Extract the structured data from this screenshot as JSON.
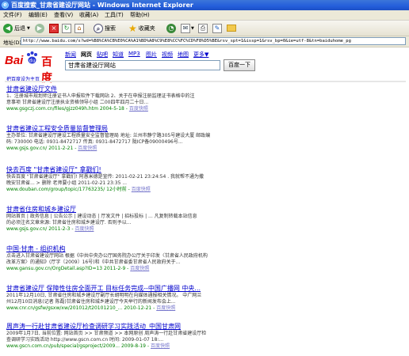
{
  "window": {
    "title": "百度搜索_甘肃省建设厅网站 - Windows Internet Explorer",
    "accent": "#245edb"
  },
  "menu": [
    "文件(F)",
    "编辑(E)",
    "查看(V)",
    "收藏(A)",
    "工具(T)",
    "帮助(H)"
  ],
  "toolbar": {
    "back": "后退",
    "search": "搜索",
    "favorites": "收藏夹",
    "icons": [
      "back-icon",
      "forward-icon",
      "stop-icon",
      "refresh-icon",
      "home-icon",
      "search-icon",
      "favorites-icon",
      "history-icon",
      "mail-icon",
      "print-icon",
      "edit-icon"
    ]
  },
  "address": {
    "label": "地址(D)",
    "url": "http://www.baidu.com/s?wd=%B8%CA%CB%E0%CA%A1%BD%A8%C9%E8%CC%FC%CD%F8%D5%BE&rsv_spt=1&issp=1&rsv_bp=0&ie=utf-8&tn=baiduhome_pg"
  },
  "baidu": {
    "logo_bai": "Bai",
    "logo_du": "百度",
    "tabs": [
      "新闻",
      "网页",
      "贴吧",
      "知道",
      "MP3",
      "图片",
      "视频",
      "地图",
      "更多▼"
    ],
    "active_tab": "网页",
    "query": "甘肃省建设厅网站",
    "button": "百度一下",
    "set_home": "把百度设为主页"
  },
  "results": [
    {
      "title": "甘肃省建设厅文件",
      "desc1": "1、注册城市规划师注册证书人申报软件下载网站 2、关于在申报注册监理证书表格中的注",
      "desc2": "意事项 甘肃省建设厅注册执业资格领导小组 二00四年四月二十日...",
      "url": "www.gsgczj.com.cn/files/gjzz049h.htm 2004-5-18",
      "snap": "百度快照"
    },
    {
      "title": "甘肃省建设工程安全质量监督管理局",
      "desc1": "主办单位: 甘肃省建设厅建设工程质量安全监督管理局 地址: 兰州市静宁路305号建设大厦 邮政编",
      "desc2": "码: 730000 电话: 0931-8472717 传真: 0931-8472717 陇ICP备09000496号...",
      "url": "www.gsjs.gov.cn/ 2011-2-21",
      "snap": "百度快照"
    },
    {
      "title": "快去百度 \"甘肃省建设厅\" 拿戳们!",
      "desc1": "快去百度 \"甘肃省建设厅\" 拿戳们! 阿愚米德是宣传: 2011-02-21 23:24:54 . 我就帮不通为撒",
      "desc2": "晚安甘肃省... > 删除 老师要小组 2011-02-21 23:35 ...",
      "url": "www.douban.com/group/topic/17763235/ 12小时前",
      "snap": "百度快照"
    },
    {
      "title": "甘肃省住房和城乡建设厅",
      "desc1": "网站首页 | 政务信息 | 公告公示 | 建设动态 | 厅发文件 | 招标投标 | ... 凡复制转载本站信息",
      "desc2": "的必须注名文章来源: 甘肃省住房和城乡建设厅. 否则予以...",
      "url": "www.gsjs.gov.cn/ 2011-2-3",
      "snap": "百度快照"
    },
    {
      "title": "中国·甘肃 - 组织机构",
      "desc1": "点击进入甘肃省建设厅网站 根据《中共中央办公厅国务院办公厅关于印发〈甘肃省人民政府机构",
      "desc2": "改革方案〉的通知》(厅字〔2009〕16号)和《中共甘肃省委甘肃省人民政府关于...",
      "url": "www.gansu.gov.cn/OrgDetail.asp?ID=13 2011-2-9",
      "snap": "百度快照"
    },
    {
      "title": "甘肃省建设厅 保障性住房全面开工 目标任务完成--中国广播网 中央...",
      "desc1": "2011年12月10日, 甘肃省住房和城乡建设厅副厅长胡明明在向媒体通报相关情况。 中广网兰",
      "desc2": "州12月10日消息(记者 陈磊)甘肃省住房和城乡建设厅今天举行的新闻发布会上...",
      "url": "www.cnr.cn/gsfw/gsxw/xw/201012/t20101210_... 2010-12-21",
      "snap": "百度快照"
    },
    {
      "title": "周声涛一行赴甘肃省建设厅检查调研学习实践活动_中国甘肃网",
      "desc1": "2009年1月7日, 当前位置: 网站首页 >> 甘肃频道 >> 本网原创 周声涛一行赴甘肃省建设厅检",
      "desc2": "查调研学习实践活动 http://www.gscn.com.cn 时间: 2009-01-07 18:...",
      "url": "www.gscn.com.cn/pub/special/gsproject/2009... 2009-8-19",
      "snap": "百度快照"
    }
  ]
}
